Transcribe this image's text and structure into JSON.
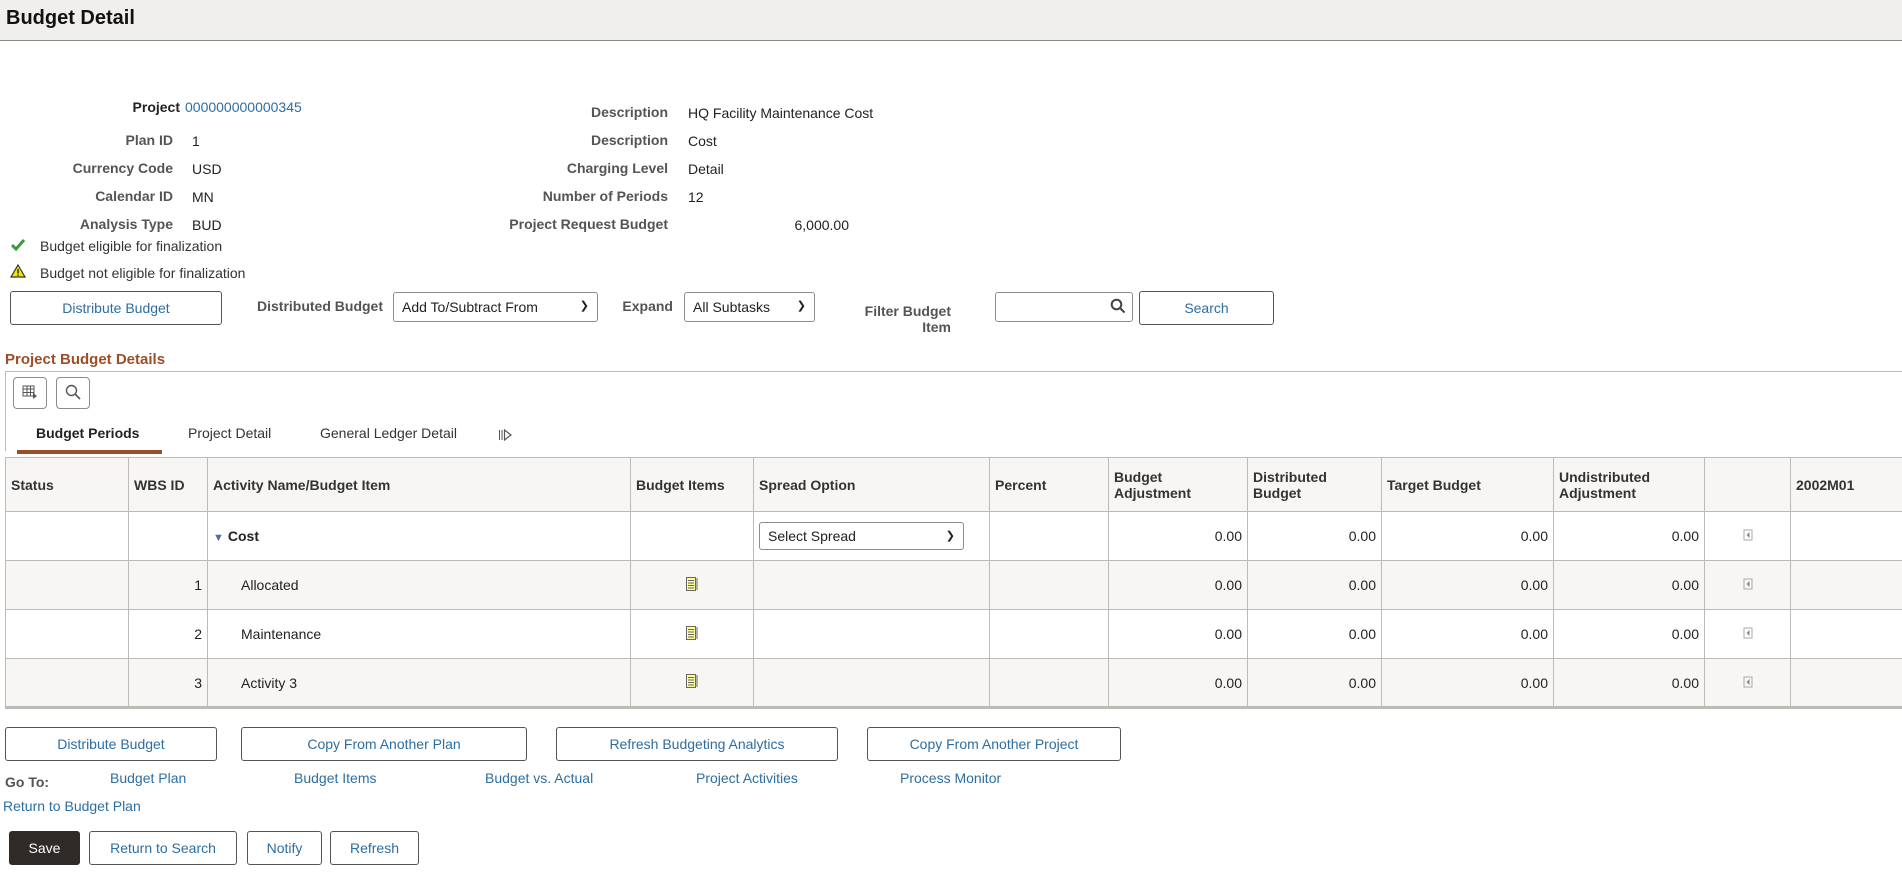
{
  "header": {
    "title": "Budget Detail"
  },
  "summary": {
    "left": [
      {
        "label": "Project",
        "value": "000000000000345",
        "is_link": true
      },
      {
        "label": "Plan ID",
        "value": "1"
      },
      {
        "label": "Currency Code",
        "value": "USD"
      },
      {
        "label": "Calendar ID",
        "value": "MN"
      },
      {
        "label": "Analysis Type",
        "value": "BUD"
      }
    ],
    "right": [
      {
        "label": "Description",
        "value": "HQ Facility Maintenance Cost"
      },
      {
        "label": "Description",
        "value": "Cost"
      },
      {
        "label": "Charging Level",
        "value": "Detail"
      },
      {
        "label": "Number of Periods",
        "value": "12"
      },
      {
        "label": "Project Request Budget",
        "value": "6,000.00"
      }
    ]
  },
  "messages": [
    {
      "icon": "checkmark-icon",
      "text": "Budget eligible for finalization",
      "color": "#3c9a3c"
    },
    {
      "icon": "warning-icon",
      "text": "Budget not eligible for finalization",
      "color": "#f2e600"
    }
  ],
  "toolbar": {
    "distribute_label": "Distribute Budget",
    "distributed_budget_label": "Distributed Budget",
    "distributed_budget_value": "Add To/Subtract From",
    "expand_label": "Expand",
    "expand_value": "All Subtasks",
    "filter_label": "Filter Budget Item",
    "filter_value": "",
    "search_label": "Search"
  },
  "section": {
    "title": "Project Budget Details",
    "tabs": [
      {
        "label": "Budget Periods",
        "active": true
      },
      {
        "label": "Project Detail",
        "active": false
      },
      {
        "label": "General Ledger Detail",
        "active": false
      }
    ]
  },
  "grid": {
    "columns": [
      "Status",
      "WBS ID",
      "Activity Name/Budget Item",
      "Budget Items",
      "Spread Option",
      "Percent",
      "Budget Adjustment",
      "Distributed Budget",
      "Target Budget",
      "Undistributed Adjustment",
      "",
      "2002M01"
    ],
    "rows": [
      {
        "status": "",
        "wbs": "",
        "name": "Cost",
        "is_parent": true,
        "spread": "Select Spread",
        "percent": "",
        "budget_adjustment": "0.00",
        "distributed_budget": "0.00",
        "target_budget": "0.00",
        "undistributed_adjustment": "0.00",
        "period": ""
      },
      {
        "status": "",
        "wbs": "1",
        "name": "Allocated",
        "is_parent": false,
        "spread": "",
        "percent": "",
        "budget_adjustment": "0.00",
        "distributed_budget": "0.00",
        "target_budget": "0.00",
        "undistributed_adjustment": "0.00",
        "period": ""
      },
      {
        "status": "",
        "wbs": "2",
        "name": "Maintenance",
        "is_parent": false,
        "spread": "",
        "percent": "",
        "budget_adjustment": "0.00",
        "distributed_budget": "0.00",
        "target_budget": "0.00",
        "undistributed_adjustment": "0.00",
        "period": ""
      },
      {
        "status": "",
        "wbs": "3",
        "name": "Activity 3",
        "is_parent": false,
        "spread": "",
        "percent": "",
        "budget_adjustment": "0.00",
        "distributed_budget": "0.00",
        "target_budget": "0.00",
        "undistributed_adjustment": "0.00",
        "period": ""
      }
    ]
  },
  "actions": {
    "distribute": "Distribute Budget",
    "copy_plan": "Copy From Another Plan",
    "refresh_analytics": "Refresh Budgeting Analytics",
    "copy_project": "Copy From Another Project"
  },
  "goto": {
    "label": "Go To:",
    "links": [
      "Budget Plan",
      "Budget Items",
      "Budget vs. Actual",
      "Project Activities",
      "Process Monitor"
    ],
    "return_link": "Return to Budget Plan"
  },
  "footer": {
    "save": "Save",
    "return_search": "Return to Search",
    "notify": "Notify",
    "refresh": "Refresh"
  }
}
